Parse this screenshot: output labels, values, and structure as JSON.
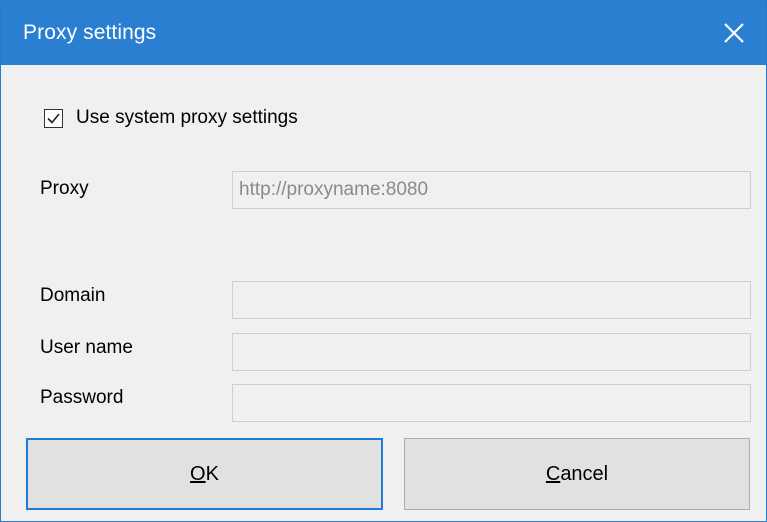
{
  "window": {
    "title": "Proxy settings"
  },
  "use_system_proxy": {
    "label": "Use system proxy settings",
    "checked": true
  },
  "fields": {
    "proxy": {
      "label": "Proxy",
      "value": "http://proxyname:8080"
    },
    "domain": {
      "label": "Domain",
      "value": ""
    },
    "username": {
      "label": "User name",
      "value": ""
    },
    "password": {
      "label": "Password",
      "value": ""
    }
  },
  "buttons": {
    "ok": {
      "mnemonic": "O",
      "rest": "K"
    },
    "cancel": {
      "mnemonic": "C",
      "rest": "ancel"
    }
  },
  "colors": {
    "titlebar": "#2b7fd1",
    "focus_border": "#1f7bd6"
  },
  "icons": {
    "close": "close-icon",
    "check": "checkmark-icon"
  }
}
